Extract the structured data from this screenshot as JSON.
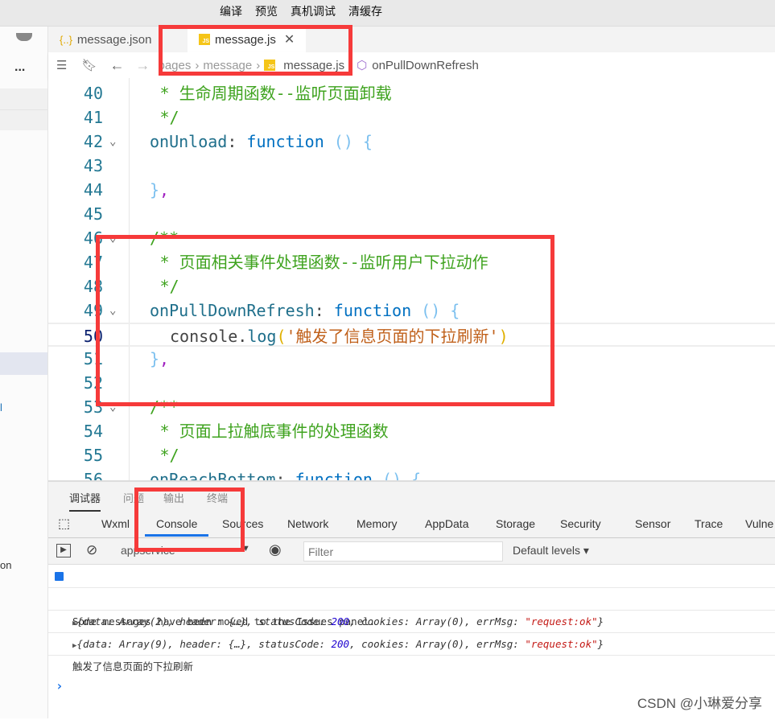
{
  "topbar": {
    "menu": [
      "编译",
      "预览",
      "真机调试",
      "清缓存"
    ]
  },
  "sidebar": {
    "more": "...",
    "fragments": [
      "l",
      "on"
    ]
  },
  "tabs": [
    {
      "label": "message.json",
      "icon": "json-icon"
    },
    {
      "label": "message.js",
      "icon": "js-icon",
      "active": true
    }
  ],
  "breadcrumb": [
    "pages",
    "message",
    "message.js",
    "onPullDownRefresh"
  ],
  "code": {
    "lines": [
      {
        "n": "40",
        "indent": 1,
        "tokens": [
          [
            "* 生命周期函数--监听页面卸载",
            "c-com"
          ]
        ]
      },
      {
        "n": "41",
        "indent": 1,
        "tokens": [
          [
            "*/",
            "c-com"
          ]
        ]
      },
      {
        "n": "42",
        "fold": true,
        "tokens": [
          [
            "onUnload",
            "c-prop"
          ],
          [
            ": ",
            "c-fn"
          ],
          [
            "function",
            "c-kw"
          ],
          [
            " () {",
            "c-par"
          ]
        ]
      },
      {
        "n": "43",
        "tokens": []
      },
      {
        "n": "44",
        "tokens": [
          [
            "}",
            "c-par"
          ],
          [
            ",",
            "c-pun"
          ]
        ]
      },
      {
        "n": "45",
        "tokens": []
      },
      {
        "n": "46",
        "fold": true,
        "tokens": [
          [
            "/**",
            "c-com"
          ]
        ]
      },
      {
        "n": "47",
        "indent": 1,
        "tokens": [
          [
            "* 页面相关事件处理函数--监听用户下拉动作",
            "c-com"
          ]
        ]
      },
      {
        "n": "48",
        "indent": 1,
        "tokens": [
          [
            "*/",
            "c-com"
          ]
        ]
      },
      {
        "n": "49",
        "fold": true,
        "tokens": [
          [
            "onPullDownRefresh",
            "c-prop"
          ],
          [
            ": ",
            "c-fn"
          ],
          [
            "function",
            "c-kw"
          ],
          [
            " () {",
            "c-par"
          ]
        ]
      },
      {
        "n": "50",
        "indent": 2,
        "current": true,
        "tokens": [
          [
            "console.",
            "c-fn"
          ],
          [
            "log",
            "c-call"
          ],
          [
            "(",
            "c-yel"
          ],
          [
            "'触发了信息页面的下拉刷新'",
            "c-str"
          ],
          [
            ")",
            "c-yel"
          ]
        ]
      },
      {
        "n": "51",
        "tokens": [
          [
            "}",
            "c-par"
          ],
          [
            ",",
            "c-pun"
          ]
        ]
      },
      {
        "n": "52",
        "tokens": []
      },
      {
        "n": "53",
        "fold": true,
        "tokens": [
          [
            "/**",
            "c-com"
          ]
        ]
      },
      {
        "n": "54",
        "indent": 1,
        "tokens": [
          [
            "* 页面上拉触底事件的处理函数",
            "c-com"
          ]
        ]
      },
      {
        "n": "55",
        "indent": 1,
        "tokens": [
          [
            "*/",
            "c-com"
          ]
        ]
      },
      {
        "n": "56",
        "fold": true,
        "tokens": [
          [
            "onReachBottom",
            "c-prop"
          ],
          [
            ": ",
            "c-fn"
          ],
          [
            "function",
            "c-kw"
          ],
          [
            " () {",
            "c-par"
          ]
        ]
      }
    ]
  },
  "devtools": {
    "top_tabs": [
      "调试器",
      "问题",
      "输出",
      "终端"
    ],
    "tabs": [
      "Wxml",
      "Console",
      "Sources",
      "Network",
      "Memory",
      "AppData",
      "Storage",
      "Security",
      "Sensor",
      "Trace",
      "Vulne"
    ],
    "active_tab": "Console",
    "context": "appservice",
    "filter_placeholder": "Filter",
    "levels": "Default levels ▾",
    "messages": {
      "info": "Some messages have been moved to the Issues panel.",
      "obj1": {
        "pre": "{data: Array(2), header: {…}, statusCode: ",
        "code": "200",
        "mid": ", cookies: Array(0), errMsg: ",
        "msg": "\"request:ok\"",
        "post": "}"
      },
      "obj2": {
        "pre": "{data: Array(9), header: {…}, statusCode: ",
        "code": "200",
        "mid": ", cookies: Array(0), errMsg: ",
        "msg": "\"request:ok\"",
        "post": "}"
      },
      "log": "触发了信息页面的下拉刷新",
      "prompt": "›"
    }
  },
  "watermark": "CSDN @小琳爱分享",
  "colors": {
    "highlight_box": "#f63a3a",
    "active_tab_underline": "#1a73e8"
  }
}
